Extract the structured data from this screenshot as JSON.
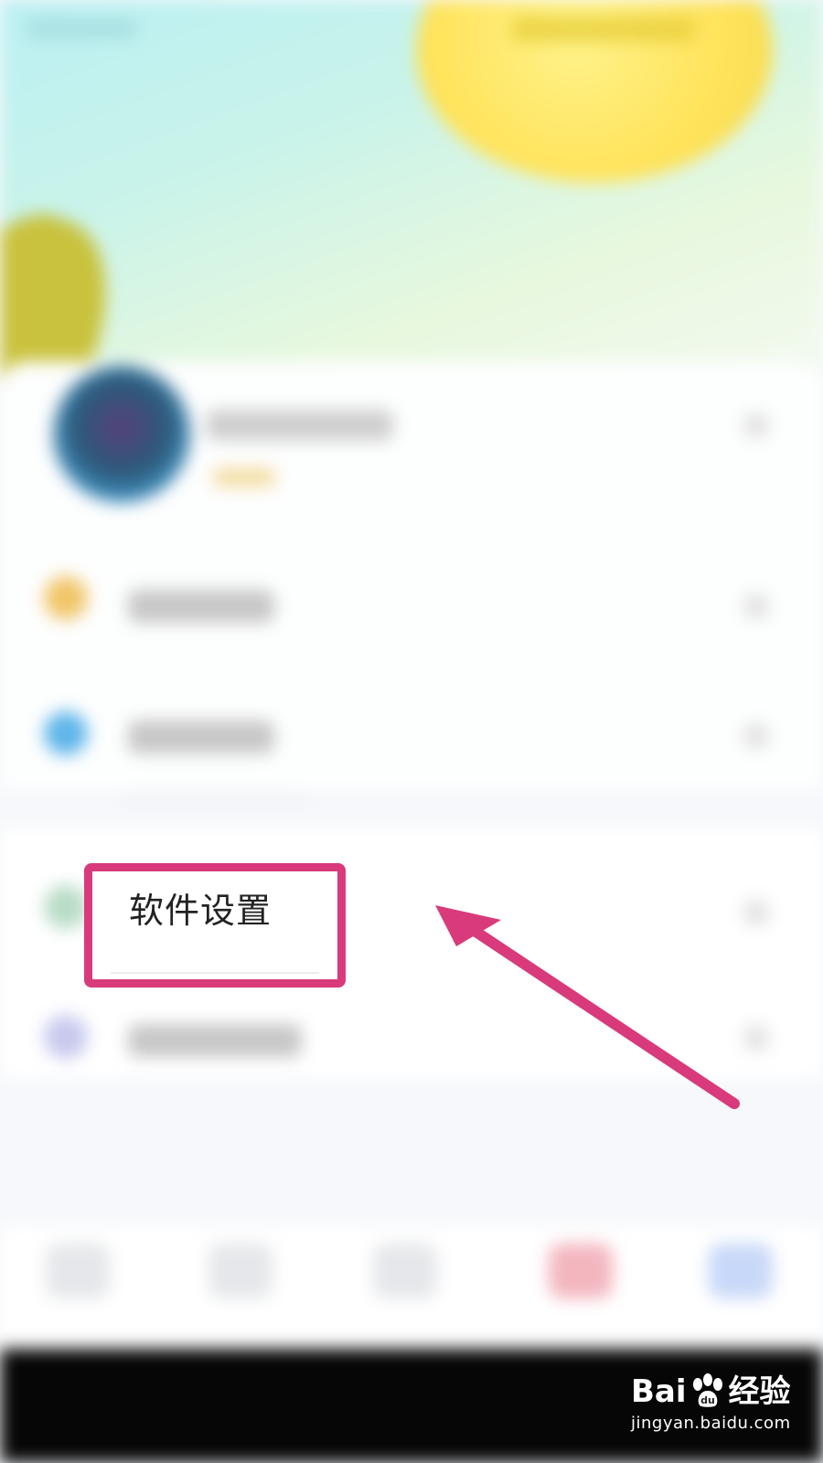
{
  "menu": {
    "highlighted_item": "软件设置"
  },
  "colors": {
    "highlight": "#d93a7b",
    "header_gradient_start": "#b8f0f5",
    "sun": "#ffe35a"
  },
  "watermark": {
    "brand": "Bai",
    "brand_suffix": "经验",
    "url": "jingyan.baidu.com"
  },
  "icons": [
    "paw-icon",
    "arrow-icon",
    "chevron-right-icon"
  ]
}
